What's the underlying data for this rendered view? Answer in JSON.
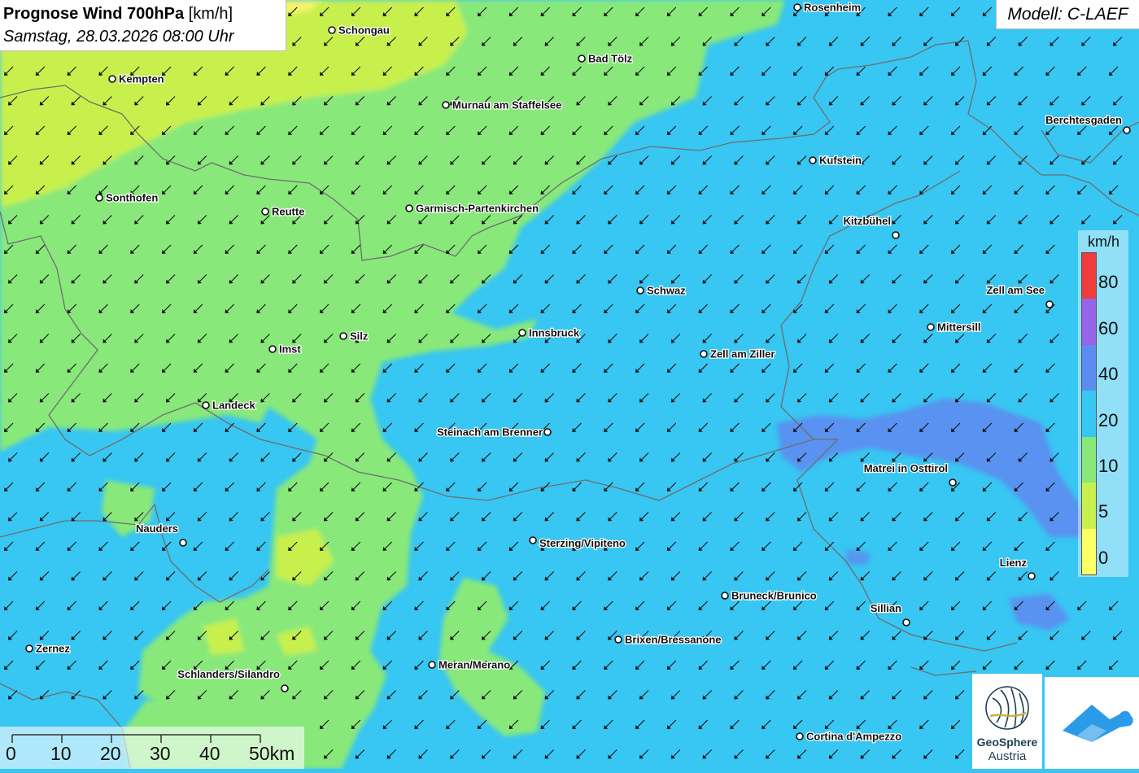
{
  "header": {
    "title_bold": "Prognose Wind 700hPa",
    "title_unit": "[km/h]",
    "datetime": "Samstag, 28.03.2026 08:00 Uhr"
  },
  "model_label": "Modell: C-LAEF",
  "legend": {
    "unit": "km/h",
    "classes": [
      {
        "label": "0",
        "color": "#ffff66"
      },
      {
        "label": "5",
        "color": "#c8f04e"
      },
      {
        "label": "10",
        "color": "#88e87a"
      },
      {
        "label": "20",
        "color": "#38c6f2"
      },
      {
        "label": "40",
        "color": "#5c8cf0"
      },
      {
        "label": "60",
        "color": "#9664e6"
      },
      {
        "label": "80",
        "color": "#f03c3c"
      }
    ]
  },
  "scalebar": {
    "labels": [
      "0",
      "10",
      "20",
      "30",
      "40",
      "50km"
    ]
  },
  "cities": [
    {
      "name": "Rosenheim"
    },
    {
      "name": "Schongau"
    },
    {
      "name": "Bad Tölz"
    },
    {
      "name": "Kempten"
    },
    {
      "name": "Murnau am Staffelsee"
    },
    {
      "name": "Berchtesgaden"
    },
    {
      "name": "Kufstein"
    },
    {
      "name": "Sonthofen"
    },
    {
      "name": "Reutte"
    },
    {
      "name": "Garmisch-Partenkirchen"
    },
    {
      "name": "Kitzbühel"
    },
    {
      "name": "Schwaz"
    },
    {
      "name": "Zell am See"
    },
    {
      "name": "Mittersill"
    },
    {
      "name": "Silz"
    },
    {
      "name": "Innsbruck"
    },
    {
      "name": "Imst"
    },
    {
      "name": "Zell am Ziller"
    },
    {
      "name": "Landeck"
    },
    {
      "name": "Steinach am Brenner"
    },
    {
      "name": "Matrei in Osttirol"
    },
    {
      "name": "Nauders"
    },
    {
      "name": "Sterzing/Vipiteno"
    },
    {
      "name": "Lienz"
    },
    {
      "name": "Bruneck/Brunico"
    },
    {
      "name": "Sillian"
    },
    {
      "name": "Brixen/Bressanone"
    },
    {
      "name": "Zernez"
    },
    {
      "name": "Meran/Merano"
    },
    {
      "name": "Schlanders/Silandro"
    },
    {
      "name": "Cortina d'Ampezzo"
    }
  ],
  "logos": {
    "geosphere_line1": "GeoSphere",
    "geosphere_line2": "Austria"
  },
  "wind_direction": "northeast"
}
